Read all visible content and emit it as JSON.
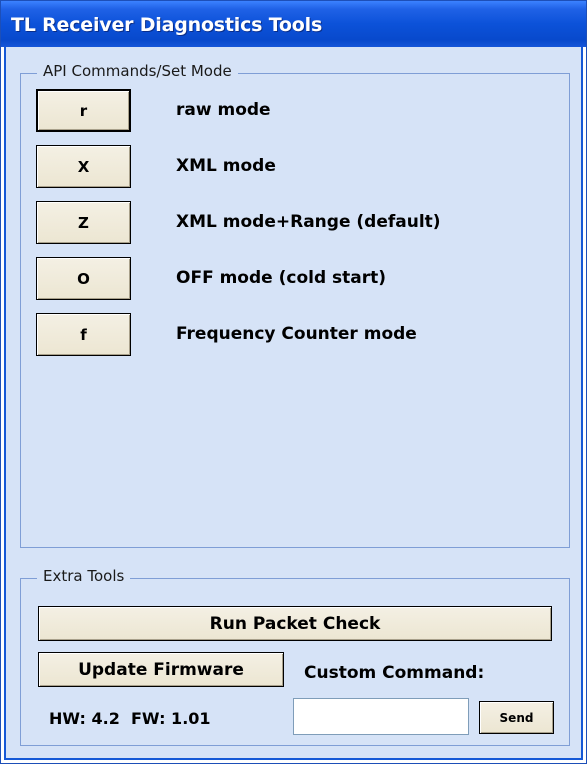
{
  "window": {
    "title": "TL Receiver Diagnostics Tools"
  },
  "api_group": {
    "legend": "API Commands/Set Mode",
    "commands": [
      {
        "key": "r",
        "label": "raw mode",
        "is_default_focus": true
      },
      {
        "key": "X",
        "label": "XML mode",
        "is_default_focus": false
      },
      {
        "key": "Z",
        "label": "XML mode+Range (default)",
        "is_default_focus": false
      },
      {
        "key": "O",
        "label": "OFF mode (cold start)",
        "is_default_focus": false
      },
      {
        "key": "f",
        "label": "Frequency Counter mode",
        "is_default_focus": false
      }
    ]
  },
  "extra_tools": {
    "legend": "Extra Tools",
    "run_packet_check_label": "Run Packet Check",
    "update_firmware_label": "Update Firmware",
    "custom_command_label": "Custom Command:",
    "custom_command_value": "",
    "send_label": "Send",
    "version_text": "HW: 4.2  FW: 1.01"
  },
  "colors": {
    "title_bar": "#0c52d9",
    "client_background": "#d6e3f7",
    "button_face": "#ece6d2",
    "group_border": "#7f9ed6"
  }
}
